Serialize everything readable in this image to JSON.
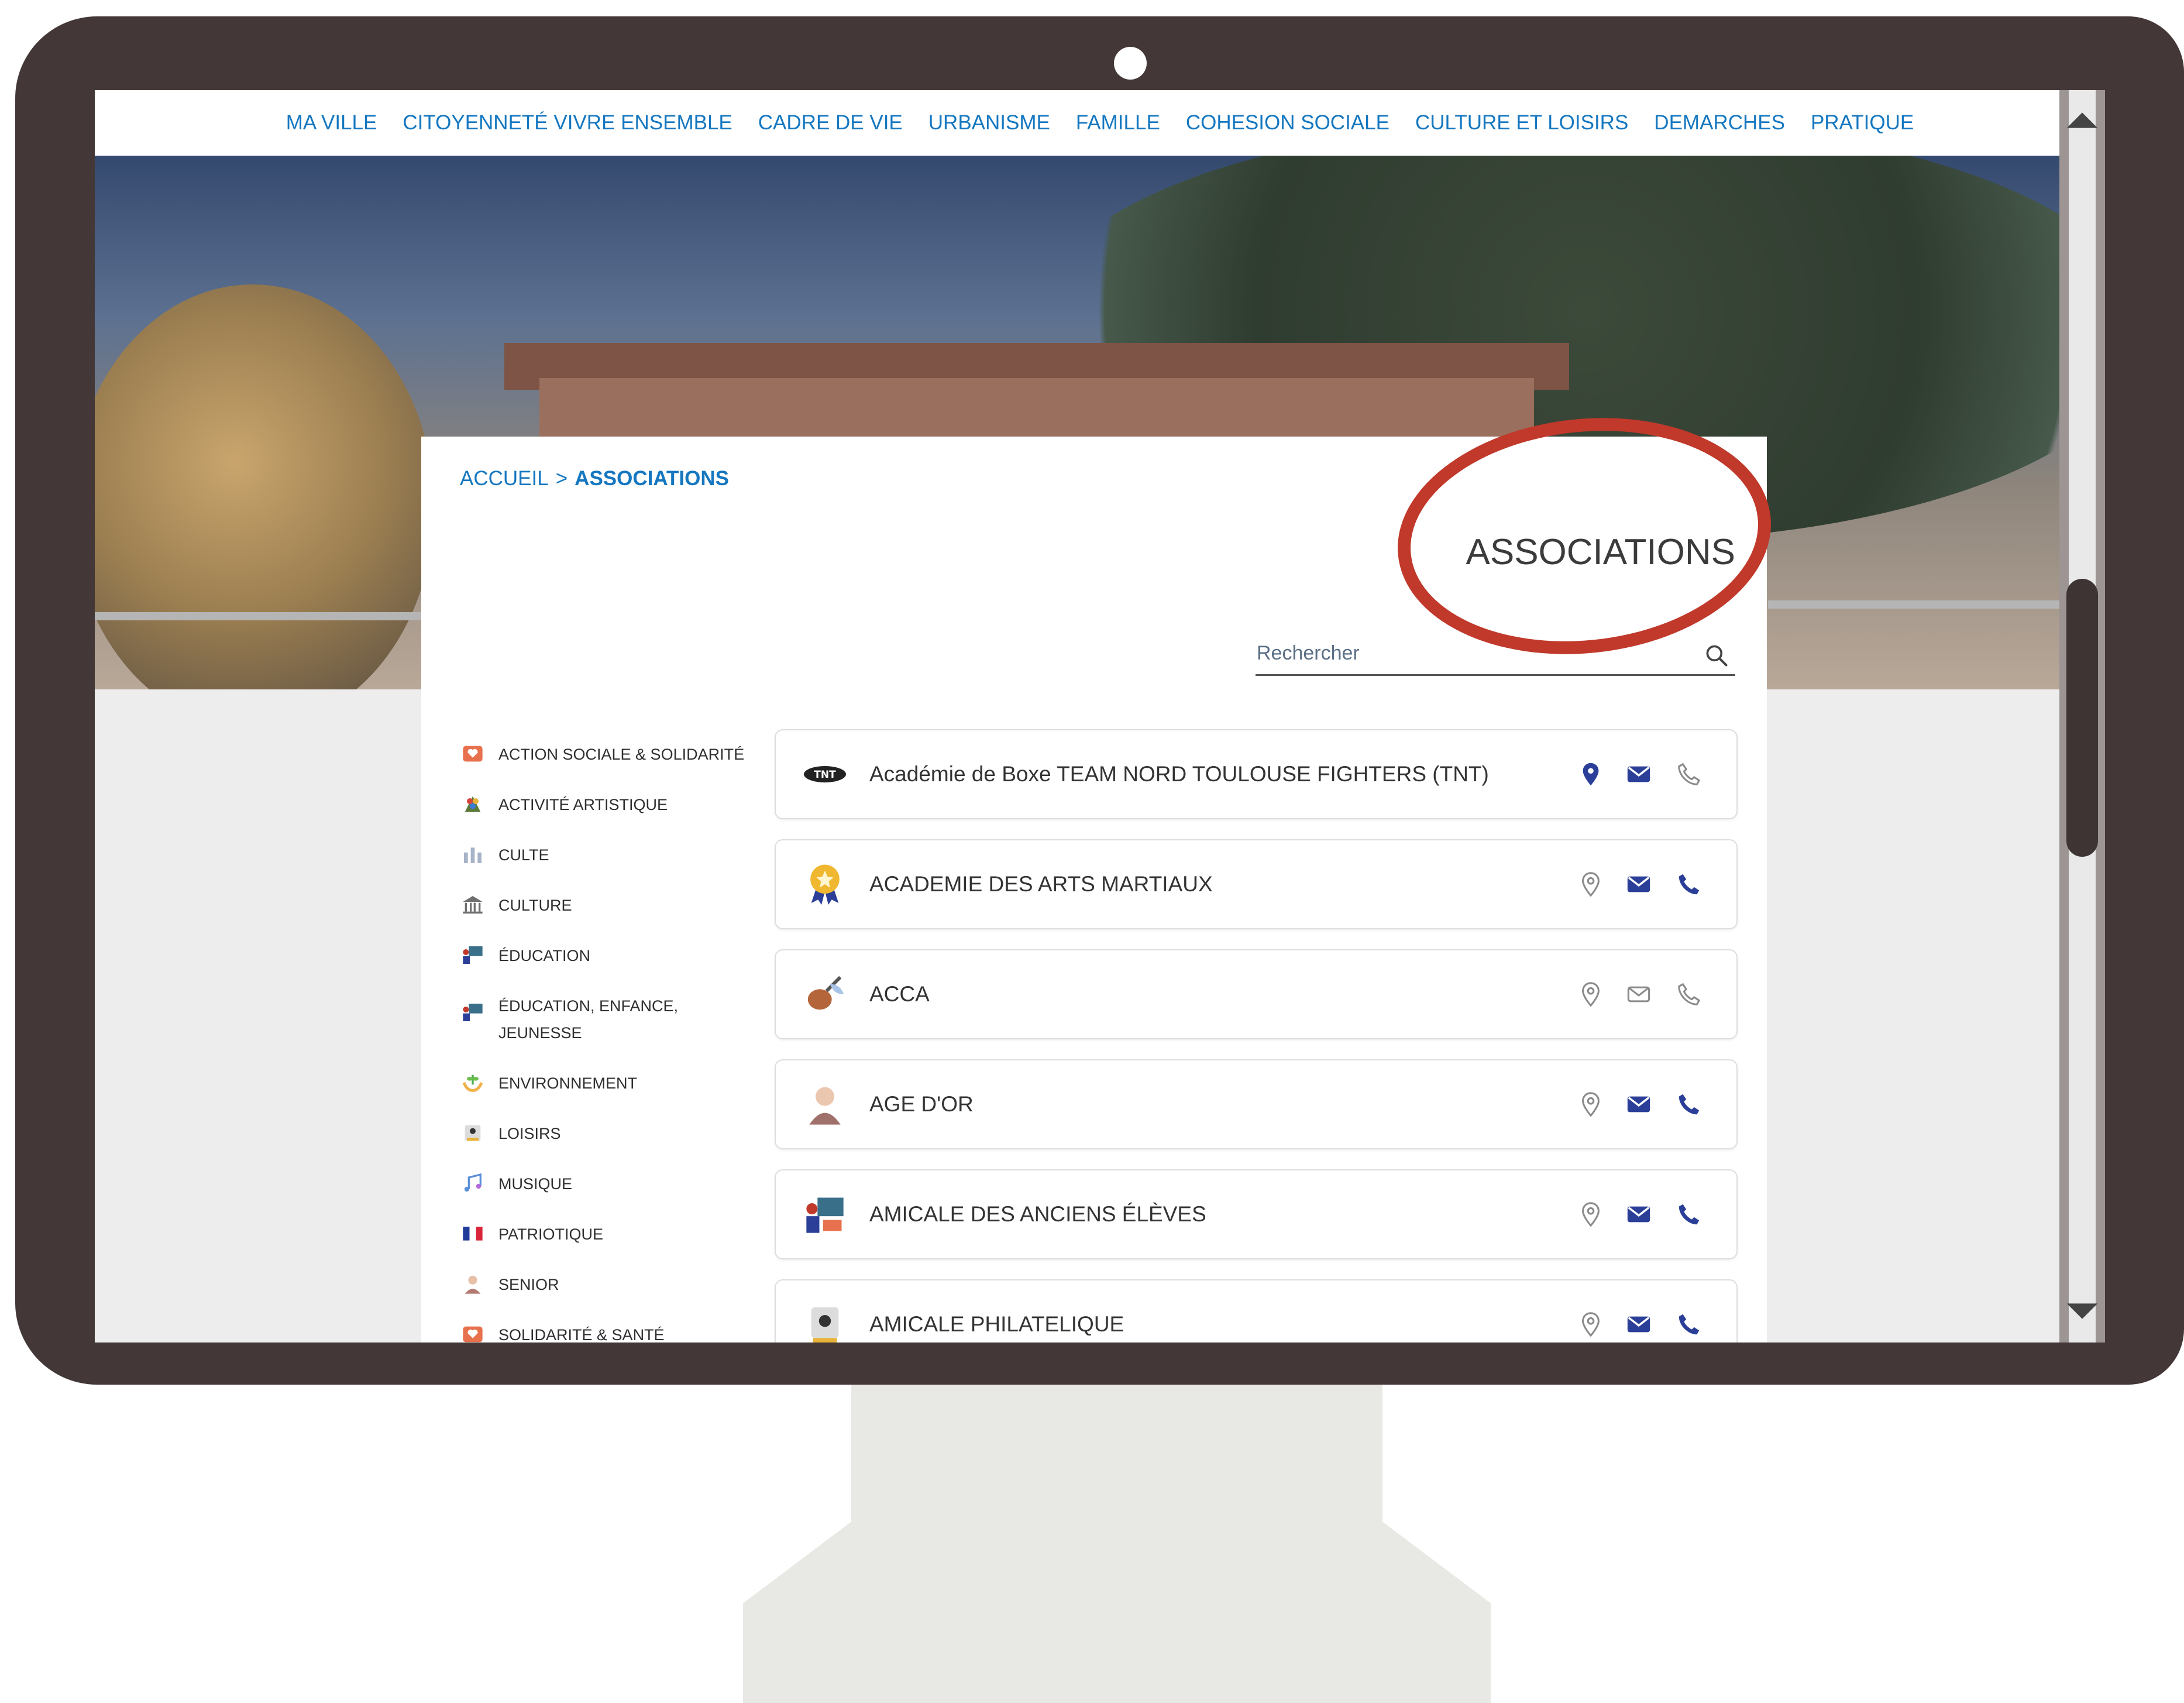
{
  "nav": [
    "MA VILLE",
    "CITOYENNETÉ VIVRE ENSEMBLE",
    "CADRE DE VIE",
    "URBANISME",
    "FAMILLE",
    "COHESION SOCIALE",
    "CULTURE ET LOISIRS",
    "DEMARCHES",
    "PRATIQUE"
  ],
  "breadcrumb": {
    "home": "ACCUEIL",
    "separator": ">",
    "current": "ASSOCIATIONS"
  },
  "page_title": "ASSOCIATIONS",
  "search": {
    "placeholder": "Rechercher",
    "icon": "search-icon"
  },
  "categories": [
    {
      "label": "ACTION SOCIALE & SOLIDARITÉ",
      "icon": "heart-hands-icon"
    },
    {
      "label": "ACTIVITÉ ARTISTIQUE",
      "icon": "palette-icon"
    },
    {
      "label": "CULTE",
      "icon": "church-icon"
    },
    {
      "label": "CULTURE",
      "icon": "museum-icon"
    },
    {
      "label": "ÉDUCATION",
      "icon": "classroom-icon"
    },
    {
      "label": "ÉDUCATION, ENFANCE, JEUNESSE",
      "icon": "classroom-icon"
    },
    {
      "label": "ENVIRONNEMENT",
      "icon": "plant-hands-icon"
    },
    {
      "label": "LOISIRS",
      "icon": "leisure-icon"
    },
    {
      "label": "MUSIQUE",
      "icon": "music-notes-icon"
    },
    {
      "label": "PATRIOTIQUE",
      "icon": "french-flag-icon"
    },
    {
      "label": "SENIOR",
      "icon": "senior-icon"
    },
    {
      "label": "SOLIDARITÉ & SANTÉ",
      "icon": "heart-hands-icon"
    }
  ],
  "associations": [
    {
      "name": "Académie de Boxe TEAM NORD TOULOUSE FIGHTERS (TNT)",
      "logo_text": "TNT",
      "location": "active",
      "email": "active",
      "phone": "inactive"
    },
    {
      "name": "ACADEMIE DES ARTS MARTIAUX",
      "location": "inactive",
      "email": "active",
      "phone": "active"
    },
    {
      "name": "ACCA",
      "location": "inactive",
      "email": "inactive",
      "phone": "inactive"
    },
    {
      "name": "AGE D'OR",
      "location": "inactive",
      "email": "active",
      "phone": "active"
    },
    {
      "name": "AMICALE DES ANCIENS ÉLÈVES",
      "location": "inactive",
      "email": "active",
      "phone": "active"
    },
    {
      "name": "AMICALE PHILATELIQUE",
      "location": "inactive",
      "email": "active",
      "phone": "active"
    }
  ],
  "colors": {
    "accent": "#1577c0",
    "icon_active": "#2b3f99",
    "icon_inactive": "#8a8a8a",
    "highlight": "#c0392b",
    "monitor": "#433737"
  }
}
